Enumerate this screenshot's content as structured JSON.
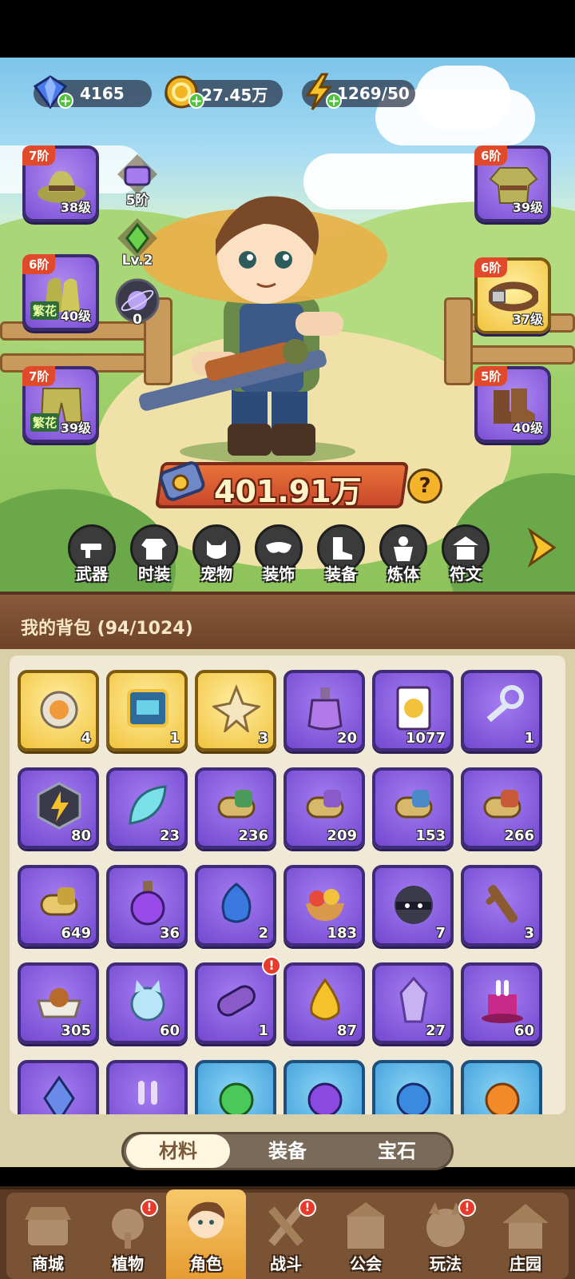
{
  "resources": {
    "gems": "4165",
    "gold": "27.45万",
    "energy": "1269/50"
  },
  "equipment": {
    "left": [
      {
        "tier": "7阶",
        "level": "38级",
        "tag": "",
        "icon": "hat-icon"
      },
      {
        "tier": "6阶",
        "level": "40级",
        "tag": "繁花",
        "icon": "gloves-icon"
      },
      {
        "tier": "7阶",
        "level": "39级",
        "tag": "繁花",
        "icon": "pants-icon"
      }
    ],
    "right": [
      {
        "tier": "6阶",
        "level": "39级",
        "tag": "",
        "icon": "shirt-icon"
      },
      {
        "tier": "6阶",
        "level": "37级",
        "tag": "",
        "icon": "belt-icon"
      },
      {
        "tier": "5阶",
        "level": "40级",
        "tag": "",
        "icon": "boots-icon"
      }
    ],
    "mid": [
      {
        "label": "5阶",
        "icon": "bag-icon"
      },
      {
        "label": "Lv.2",
        "icon": "crystal-icon"
      },
      {
        "label": "0",
        "icon": "galaxy-icon"
      }
    ]
  },
  "power": "401.91万",
  "categories": [
    "武器",
    "时装",
    "宠物",
    "装饰",
    "装备",
    "炼体",
    "符文"
  ],
  "backpack": {
    "title": "我的背包 (94/1024)",
    "items": [
      {
        "count": "4",
        "style": "gold",
        "icon": "can-icon"
      },
      {
        "count": "1",
        "style": "gold",
        "icon": "card-chip-icon"
      },
      {
        "count": "3",
        "style": "gold",
        "icon": "star-knot-icon"
      },
      {
        "count": "20",
        "style": "purple",
        "icon": "potion-icon"
      },
      {
        "count": "1077",
        "style": "purple",
        "icon": "joker-card-icon"
      },
      {
        "count": "1",
        "style": "purple",
        "icon": "key-icon"
      },
      {
        "count": "80",
        "style": "purple",
        "icon": "bolt-badge-icon"
      },
      {
        "count": "23",
        "style": "purple",
        "icon": "leaf-icon"
      },
      {
        "count": "236",
        "style": "purple",
        "icon": "scroll-green-icon"
      },
      {
        "count": "209",
        "style": "purple",
        "icon": "scroll-purple-icon"
      },
      {
        "count": "153",
        "style": "purple",
        "icon": "scroll-blue-icon"
      },
      {
        "count": "266",
        "style": "purple",
        "icon": "scroll-red-icon"
      },
      {
        "count": "649",
        "style": "purple",
        "icon": "scroll-gold-icon"
      },
      {
        "count": "36",
        "style": "purple",
        "icon": "flask-icon"
      },
      {
        "count": "2",
        "style": "purple",
        "icon": "blue-bud-icon"
      },
      {
        "count": "183",
        "style": "purple",
        "icon": "fruit-bowl-icon"
      },
      {
        "count": "7",
        "style": "purple",
        "icon": "masked-thief-icon"
      },
      {
        "count": "3",
        "style": "purple",
        "icon": "branch-icon"
      },
      {
        "count": "305",
        "style": "purple",
        "icon": "pet-bowl-icon"
      },
      {
        "count": "60",
        "style": "purple",
        "icon": "puzzle-cat-icon"
      },
      {
        "count": "1",
        "style": "purple",
        "icon": "capsule-icon",
        "badge": "!"
      },
      {
        "count": "87",
        "style": "purple",
        "icon": "golden-drop-icon"
      },
      {
        "count": "27",
        "style": "purple",
        "icon": "crystal-shard-icon"
      },
      {
        "count": "60",
        "style": "purple",
        "icon": "magic-hat-icon"
      },
      {
        "count": "",
        "style": "purple",
        "icon": "blue-crystal-icon"
      },
      {
        "count": "",
        "style": "purple",
        "icon": "bunny-ears-icon"
      },
      {
        "count": "",
        "style": "blue",
        "icon": "green-fruit-icon"
      },
      {
        "count": "",
        "style": "blue",
        "icon": "purple-fruit-icon"
      },
      {
        "count": "",
        "style": "blue",
        "icon": "blue-fruit-icon"
      },
      {
        "count": "",
        "style": "blue",
        "icon": "orange-fruit-icon"
      }
    ]
  },
  "tabs": {
    "materials": "材料",
    "equipment": "装备",
    "gems": "宝石",
    "active": "材料"
  },
  "nav": [
    {
      "label": "商城",
      "badge": ""
    },
    {
      "label": "植物",
      "badge": "!"
    },
    {
      "label": "角色",
      "badge": ""
    },
    {
      "label": "战斗",
      "badge": "!"
    },
    {
      "label": "公会",
      "badge": ""
    },
    {
      "label": "玩法",
      "badge": "!"
    },
    {
      "label": "庄园",
      "badge": ""
    }
  ]
}
